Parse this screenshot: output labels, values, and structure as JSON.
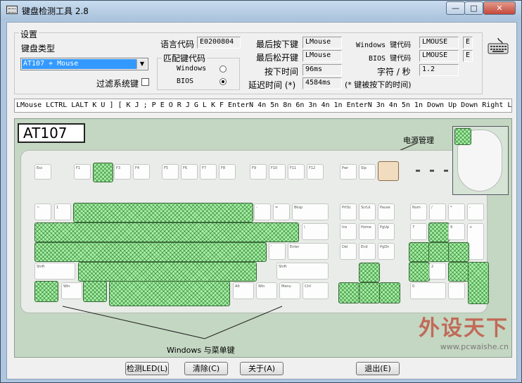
{
  "window": {
    "title": "键盘检测工具 2.8",
    "min": "—",
    "max": "□",
    "close": "✕"
  },
  "settings": {
    "group_title": "设置",
    "kb_type_label": "键盘类型",
    "kb_type_value": "AT107 + Mouse",
    "filter_label": "过滤系统键",
    "lang_label": "语言代码",
    "lang_value": "E0200804",
    "match_group": "匹配键代码",
    "opt_windows": "Windows",
    "opt_bios": "BIOS",
    "selected": "BIOS"
  },
  "status": {
    "last_down_label": "最后按下键",
    "last_down": "LMouse",
    "last_up_label": "最后松开键",
    "last_up": "LMouse",
    "press_time_label": "按下时间",
    "press_time": "96ms",
    "delay_label": "延迟时间 (*)",
    "delay": "4584ms",
    "delay_note": "(* 键被按下的时间)",
    "win_code_label": "Windows 键代码",
    "win_code": "LMOUSE",
    "win_code_ext": "E",
    "bios_code_label": "BIOS 键代码",
    "bios_code": "LMOUSE",
    "bios_code_ext": "E",
    "cps_label": "字符 / 秒",
    "cps": "1.2"
  },
  "keystream": "LMouse LCTRL LALT K U ] [ K J ; P E O R J G L K F EnterN 4n 5n 8n 6n 3n 4n 1n EnterN 3n 4n 5n 1n Down Up Down Right L",
  "keyboard": {
    "model": "AT107",
    "power_label": "电源管理",
    "winmenu_label": "Windows 与菜单键"
  },
  "buttons": {
    "led": "检测LED(L)",
    "clear": "清除(C)",
    "about": "关于(A)",
    "exit": "退出(E)"
  },
  "watermark": {
    "brand": "外设天下",
    "url": "www.pcwaishe.cn"
  }
}
